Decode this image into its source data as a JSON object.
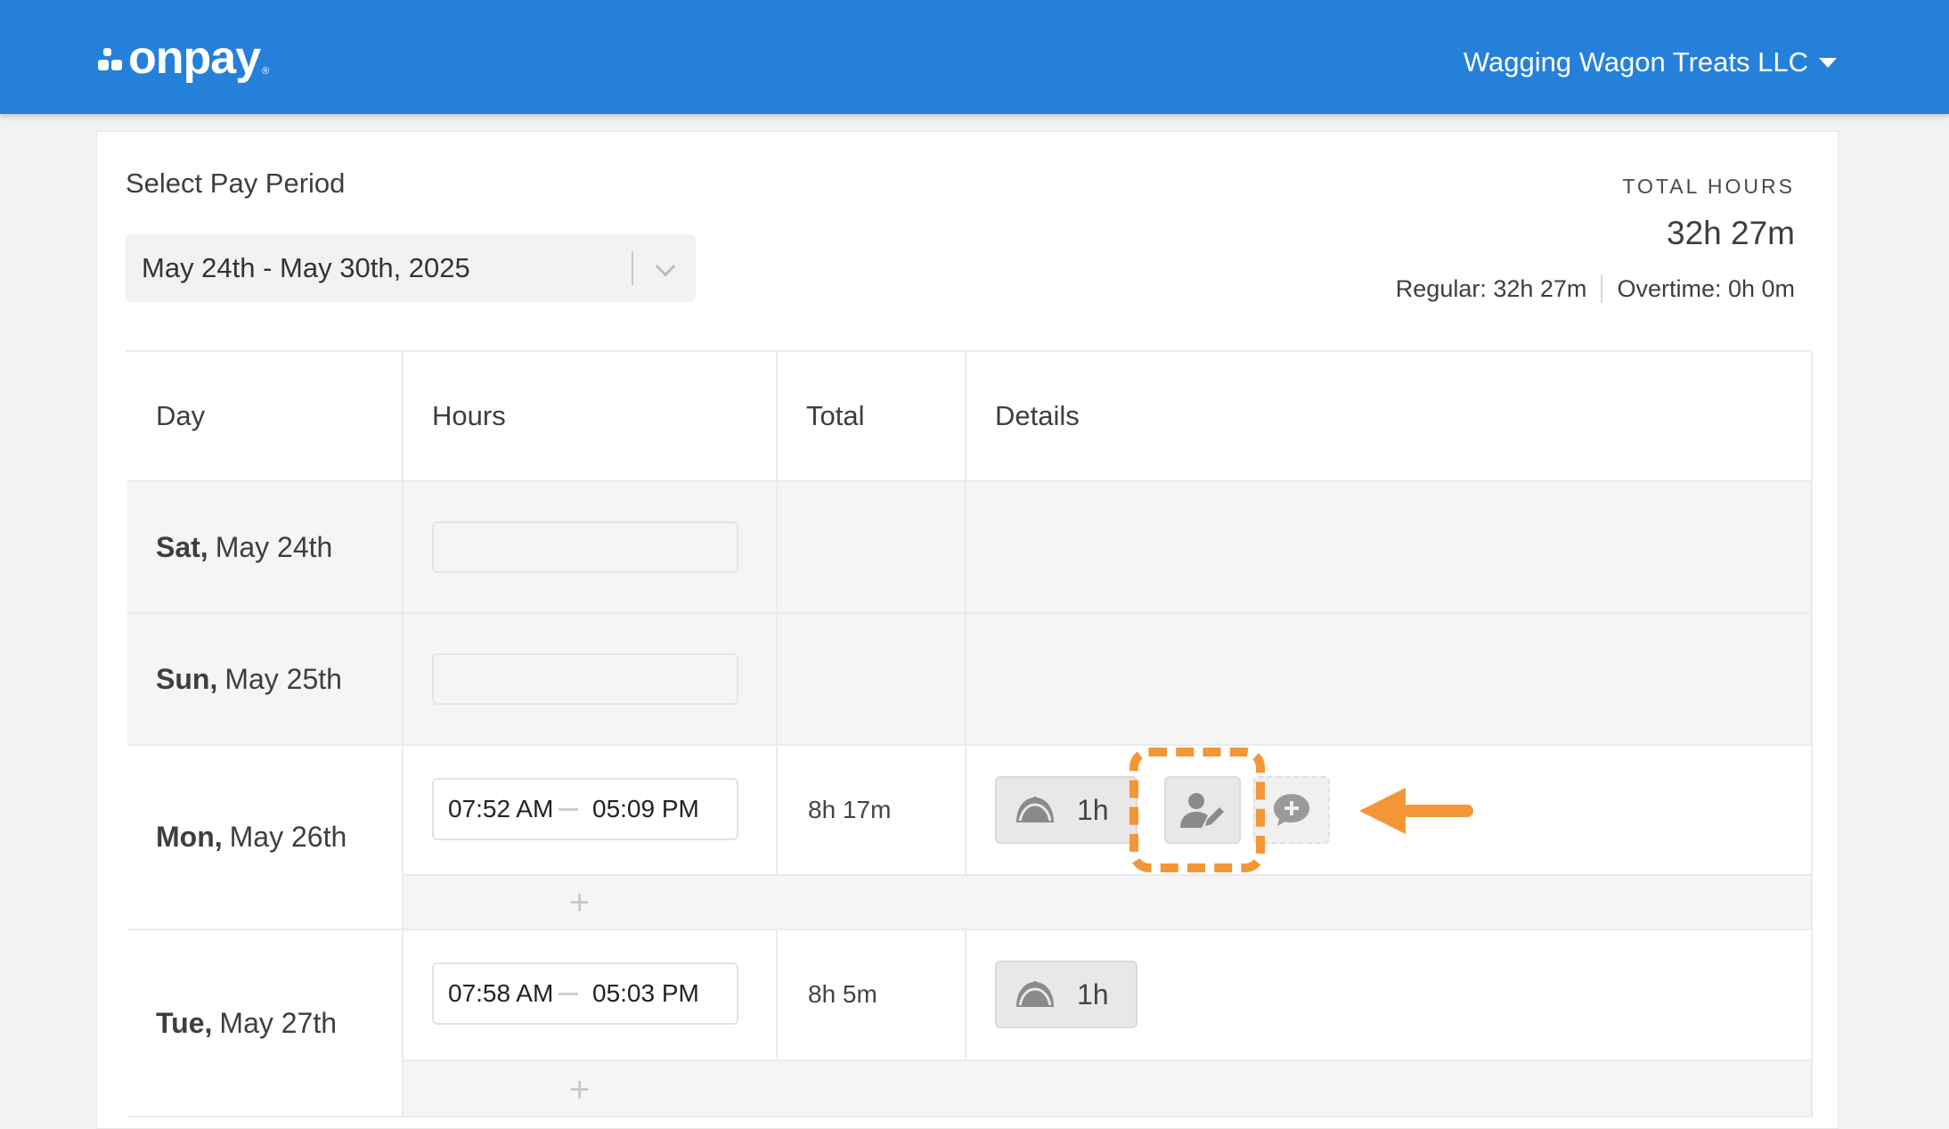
{
  "header": {
    "logo_text": "onpay",
    "logo_reg": "®",
    "company_name": "Wagging Wagon Treats LLC"
  },
  "pay_period": {
    "label": "Select Pay Period",
    "selected": "May 24th - May 30th, 2025"
  },
  "totals": {
    "label": "TOTAL HOURS",
    "value": "32h 27m",
    "regular": "Regular: 32h 27m",
    "overtime": "Overtime: 0h 0m"
  },
  "table": {
    "headers": [
      "Day",
      "Hours",
      "Total",
      "Details"
    ],
    "rows": [
      {
        "weekday": "Sat,",
        "date": "May 24th",
        "clock_in": "",
        "clock_out": "",
        "total": "",
        "break": ""
      },
      {
        "weekday": "Sun,",
        "date": "May 25th",
        "clock_in": "",
        "clock_out": "",
        "total": "",
        "break": ""
      },
      {
        "weekday": "Mon,",
        "date": "May 26th",
        "clock_in": "07:52 AM",
        "clock_out": "05:09 PM",
        "total": "8h 17m",
        "break": "1h"
      },
      {
        "weekday": "Tue,",
        "date": "May 27th",
        "clock_in": "07:58 AM",
        "clock_out": "05:03 PM",
        "total": "8h 5m",
        "break": "1h"
      }
    ],
    "add_symbol": "+"
  },
  "icons": {
    "break": "taco-icon",
    "edit": "user-edit-icon",
    "comment": "add-comment-icon",
    "pointer": "arrow-left-icon"
  },
  "colors": {
    "topbar": "#2580da",
    "highlight": "#f39637"
  }
}
